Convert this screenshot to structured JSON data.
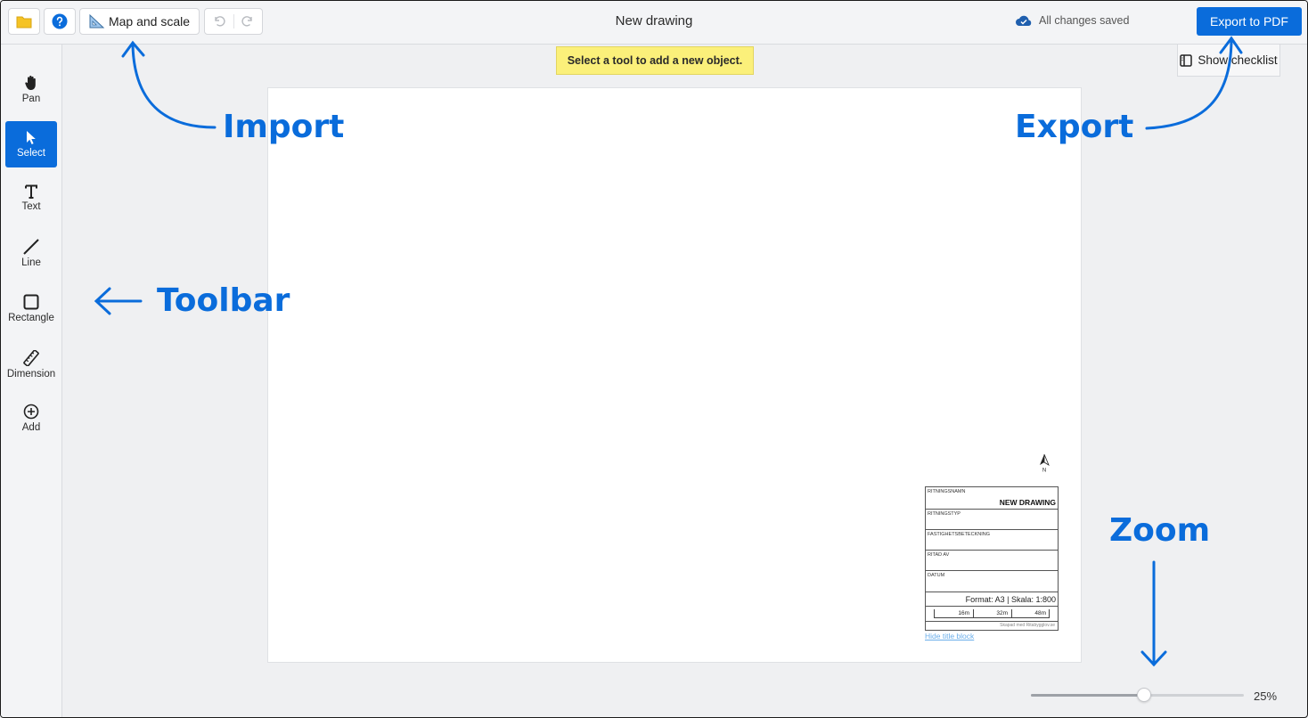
{
  "topbar": {
    "map_scale_label": "Map and scale",
    "title": "New drawing",
    "saved_status": "All changes saved",
    "export_label": "Export to PDF"
  },
  "toolbar": {
    "tools": [
      {
        "label": "Pan",
        "icon": "hand-icon",
        "active": false
      },
      {
        "label": "Select",
        "icon": "cursor-icon",
        "active": true
      },
      {
        "label": "Text",
        "icon": "text-icon",
        "active": false
      },
      {
        "label": "Line",
        "icon": "line-icon",
        "active": false
      },
      {
        "label": "Rectangle",
        "icon": "rectangle-icon",
        "active": false
      },
      {
        "label": "Dimension",
        "icon": "ruler-icon",
        "active": false
      },
      {
        "label": "Add",
        "icon": "plus-circle-icon",
        "active": false
      }
    ]
  },
  "hint": "Select a tool to add a new object.",
  "checklist_label": "Show checklist",
  "title_block": {
    "name_key": "RITNINGSNAMN",
    "name_value": "NEW DRAWING",
    "type_key": "RITNINGSTYP",
    "property_key": "FASTIGHETSBETECKNING",
    "drawn_by_key": "RITAD AV",
    "date_key": "DATUM",
    "format_text": "Format: A3 | Skala: 1:800",
    "scale_marks": [
      "16m",
      "32m",
      "48m"
    ],
    "credit": "Skapad med Ritabygglov.se",
    "north_label": "N",
    "hide_label": "Hide title block"
  },
  "zoom": {
    "value": 25,
    "label": "25%"
  },
  "annotations": {
    "import": "Import",
    "export": "Export",
    "toolbar": "Toolbar",
    "zoom": "Zoom"
  },
  "colors": {
    "accent": "#0a6cdb",
    "hint_bg": "#fbf07a",
    "folder": "#f5c325"
  }
}
